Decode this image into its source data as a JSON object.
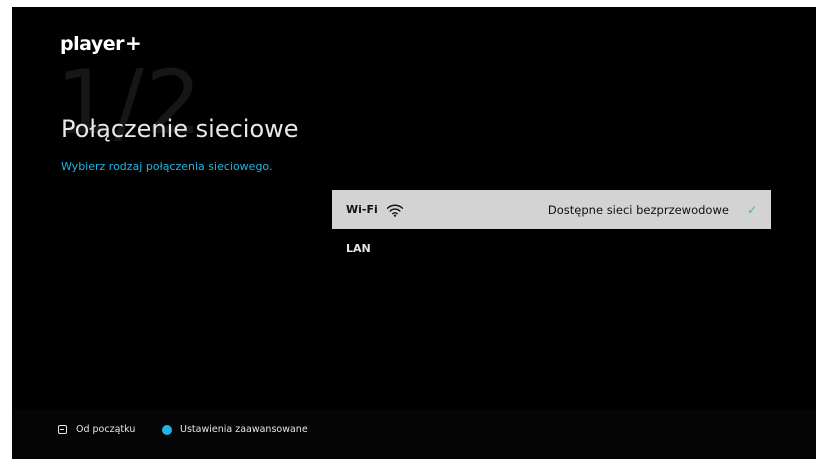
{
  "brand": {
    "logo_text": "player",
    "logo_plus": "+"
  },
  "step": {
    "indicator": "1/2"
  },
  "page": {
    "title": "Połączenie sieciowe",
    "subtitle": "Wybierz rodzaj połączenia sieciowego."
  },
  "options": [
    {
      "label": "Wi-Fi",
      "icon": "wifi-icon",
      "status": "Dostępne sieci bezprzewodowe",
      "check": "✓",
      "selected": true
    },
    {
      "label": "LAN",
      "selected": false
    }
  ],
  "footer": {
    "restart_label": "Od początku",
    "advanced_label": "Ustawienia zaawansowane"
  },
  "colors": {
    "background": "#000000",
    "accent_blue": "#1fb6e3",
    "selected_row": "#d3d3d3",
    "check_green": "#39c46a"
  }
}
